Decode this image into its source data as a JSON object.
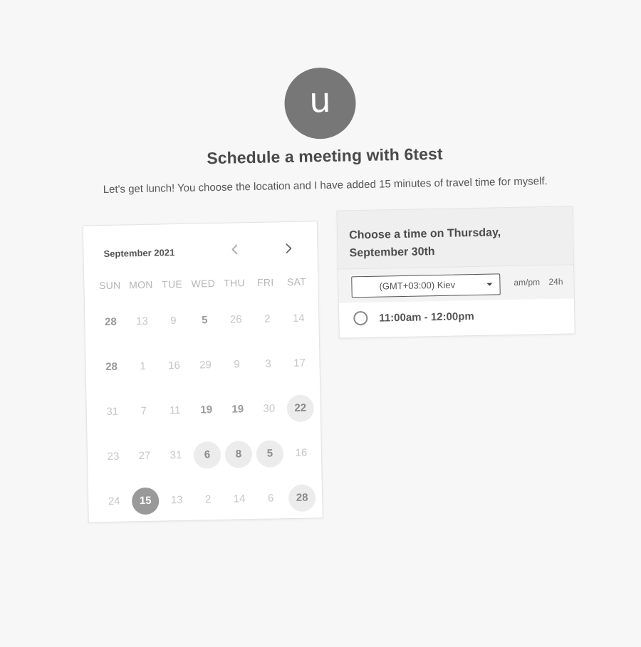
{
  "host": {
    "avatar_letter": "u",
    "title": "Schedule a meeting with 6test",
    "description": "Let's get lunch! You choose the location and I have added 15 minutes of travel time for myself."
  },
  "calendar": {
    "month_label": "September 2021",
    "prev_icon": "chevron-left-icon",
    "next_icon": "chevron-right-icon",
    "weekdays": [
      "SUN",
      "MON",
      "TUE",
      "WED",
      "THU",
      "FRI",
      "SAT"
    ],
    "weeks": [
      [
        {
          "label": "28",
          "state": "dark"
        },
        {
          "label": "13",
          "state": "muted"
        },
        {
          "label": "9",
          "state": "muted"
        },
        {
          "label": "5",
          "state": "dark"
        },
        {
          "label": "26",
          "state": "muted"
        },
        {
          "label": "2",
          "state": "muted"
        },
        {
          "label": "14",
          "state": "muted"
        }
      ],
      [
        {
          "label": "28",
          "state": "dark"
        },
        {
          "label": "1",
          "state": "muted"
        },
        {
          "label": "16",
          "state": "muted"
        },
        {
          "label": "29",
          "state": "muted"
        },
        {
          "label": "9",
          "state": "muted"
        },
        {
          "label": "3",
          "state": "muted"
        },
        {
          "label": "17",
          "state": "muted"
        }
      ],
      [
        {
          "label": "31",
          "state": "muted"
        },
        {
          "label": "7",
          "state": "muted"
        },
        {
          "label": "11",
          "state": "muted"
        },
        {
          "label": "19",
          "state": "dark"
        },
        {
          "label": "19",
          "state": "dark"
        },
        {
          "label": "30",
          "state": "muted"
        },
        {
          "label": "22",
          "state": "avail"
        }
      ],
      [
        {
          "label": "23",
          "state": "muted"
        },
        {
          "label": "27",
          "state": "muted"
        },
        {
          "label": "31",
          "state": "muted"
        },
        {
          "label": "6",
          "state": "avail"
        },
        {
          "label": "8",
          "state": "avail"
        },
        {
          "label": "5",
          "state": "avail"
        },
        {
          "label": "16",
          "state": "muted"
        }
      ],
      [
        {
          "label": "24",
          "state": "muted"
        },
        {
          "label": "15",
          "state": "sel"
        },
        {
          "label": "13",
          "state": "muted"
        },
        {
          "label": "2",
          "state": "muted"
        },
        {
          "label": "14",
          "state": "muted"
        },
        {
          "label": "6",
          "state": "muted"
        },
        {
          "label": "28",
          "state": "avail"
        }
      ]
    ]
  },
  "times": {
    "heading": "Choose a time on Thursday, September 30th",
    "timezone": "(GMT+03:00) Kiev",
    "format_ampm": "am/pm",
    "format_24h": "24h",
    "slots": [
      "11:00am - 12:00pm"
    ]
  }
}
